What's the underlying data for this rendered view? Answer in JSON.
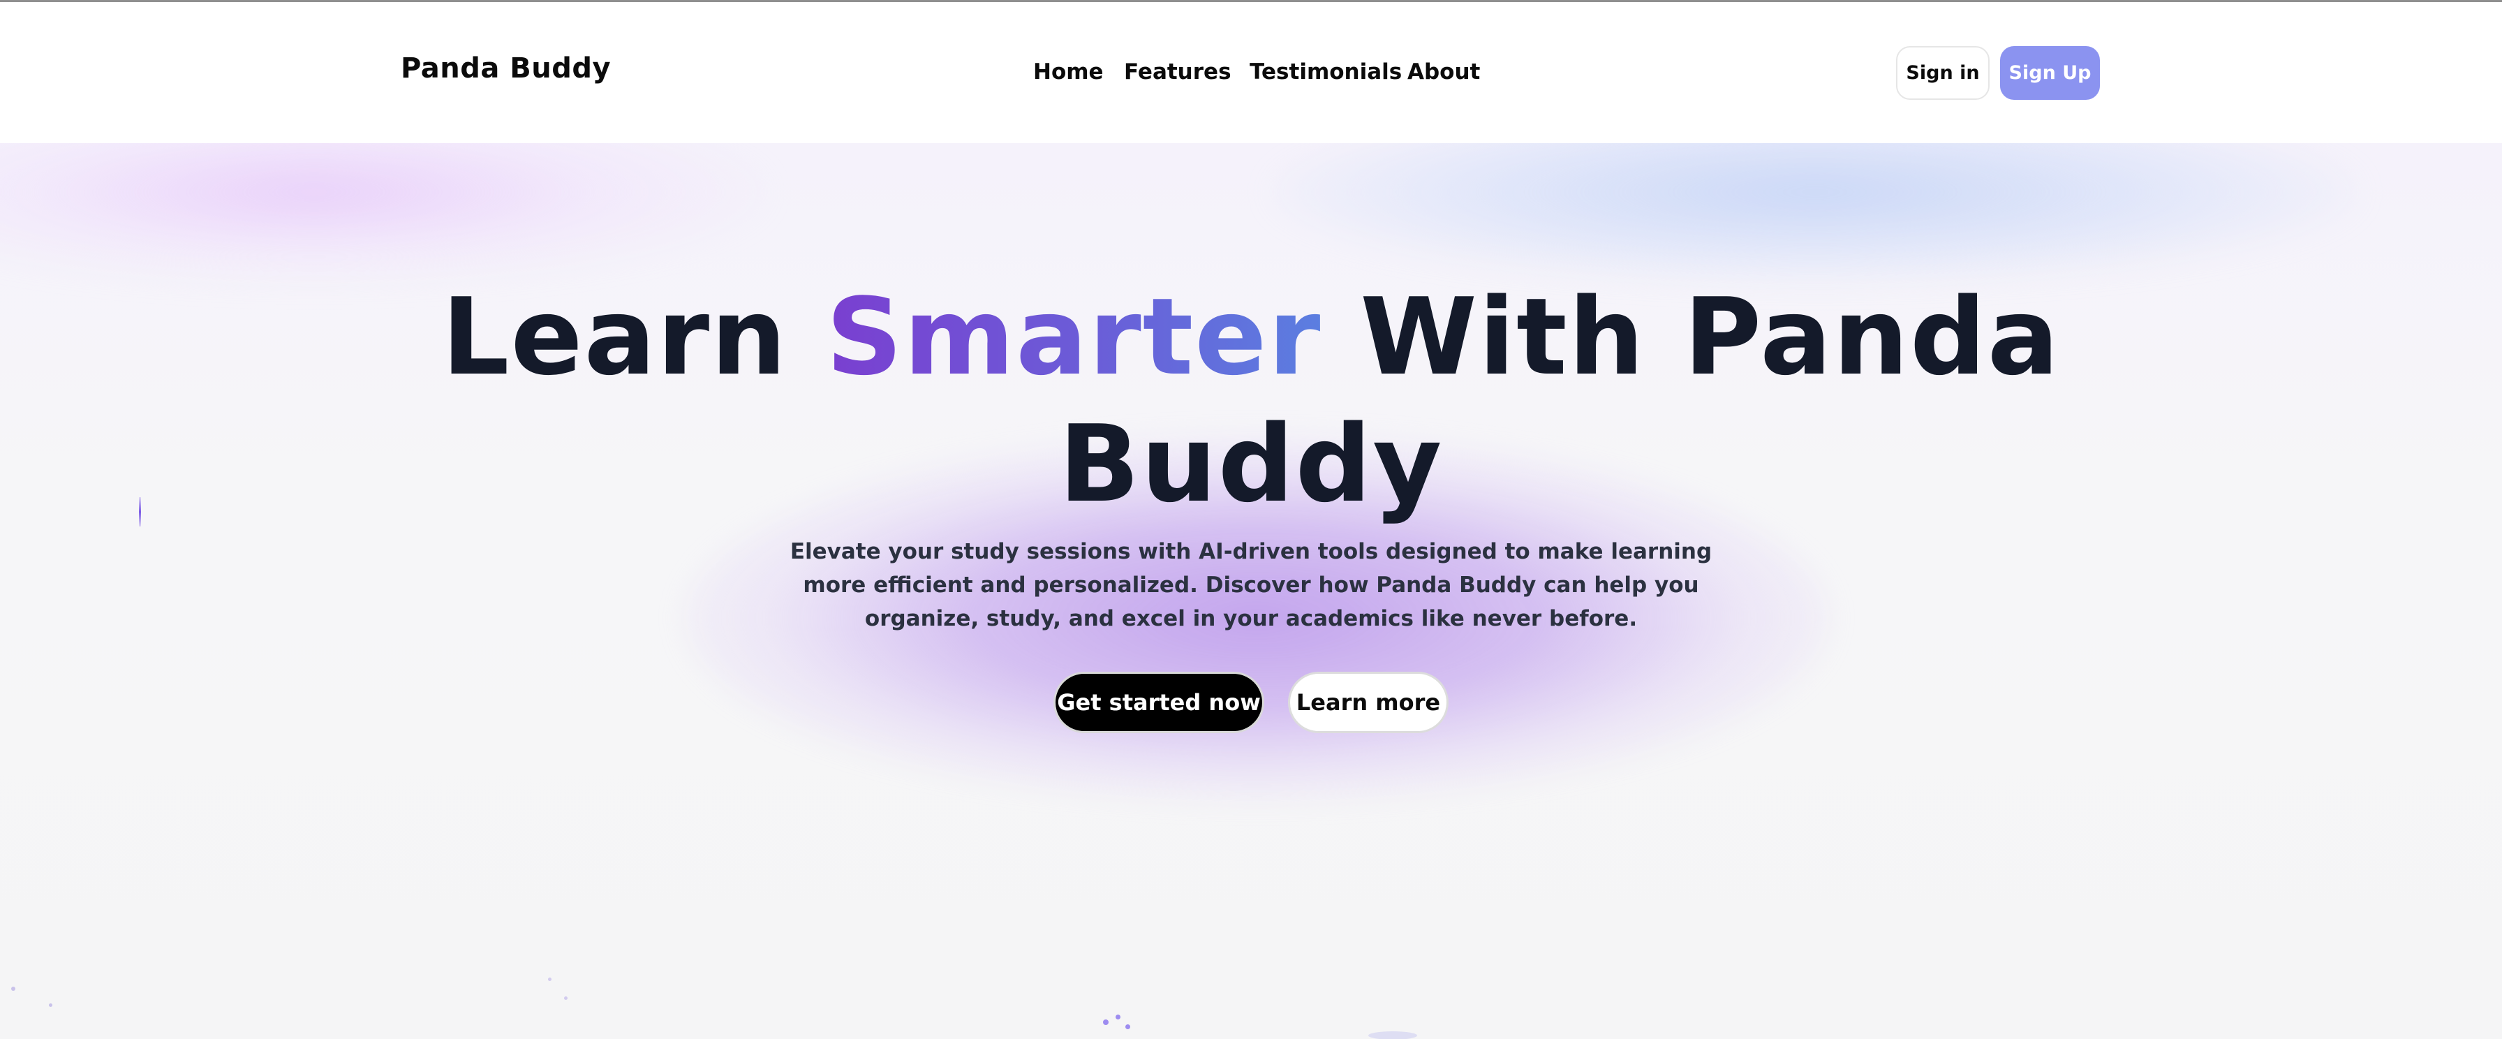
{
  "header": {
    "brand": "Panda Buddy",
    "nav": [
      "Home",
      "Features",
      "Testimonials",
      "About"
    ],
    "sign_in": "Sign in",
    "sign_up": "Sign Up"
  },
  "hero": {
    "title_part1": "Learn ",
    "title_highlight": "Smarter",
    "title_part2": " With Panda",
    "title_line2": "Buddy",
    "description": "Elevate your study sessions with AI-driven tools designed to make learning more efficient and personalized. Discover how Panda Buddy can help you organize, study, and excel in your academics like never before.",
    "primary_cta": "Get started now",
    "secondary_cta": "Learn more"
  },
  "colors": {
    "accent": "#8b93f0",
    "gradient_start": "#7a3fd0",
    "gradient_end": "#5b7ee0",
    "text_dark": "#141a2a"
  }
}
